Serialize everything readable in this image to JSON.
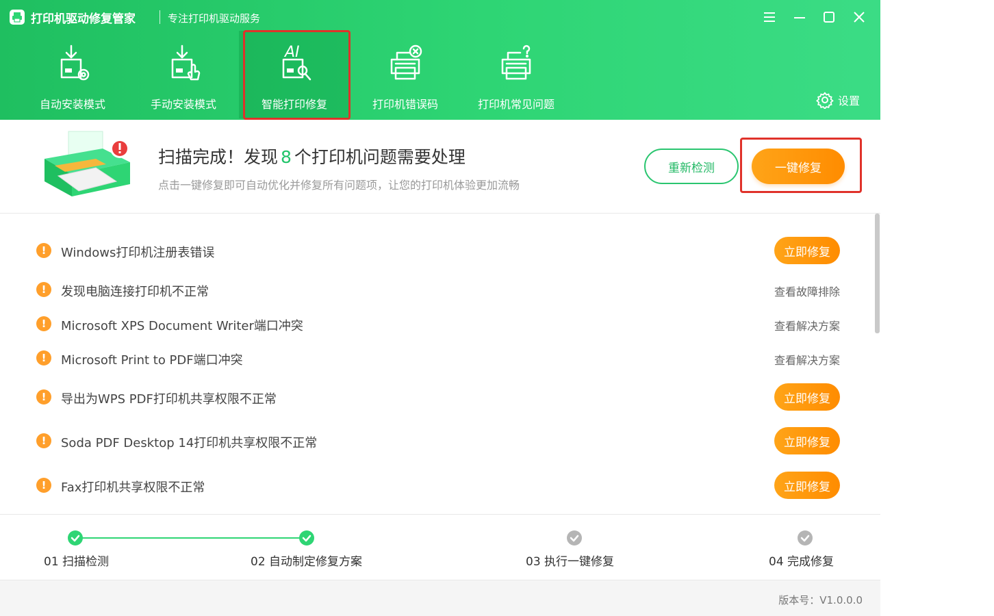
{
  "header": {
    "app_title": "打印机驱动修复管家",
    "app_subtitle": "专注打印机驱动服务",
    "settings_label": "设置",
    "window_controls": [
      "menu-icon",
      "minimize-icon",
      "maximize-icon",
      "close-icon"
    ]
  },
  "nav": {
    "items": [
      {
        "label": "自动安装模式",
        "icon": "auto-install-icon"
      },
      {
        "label": "手动安装模式",
        "icon": "manual-install-icon"
      },
      {
        "label": "智能打印修复",
        "icon": "ai-repair-icon",
        "active": true,
        "icon_text": "AI"
      },
      {
        "label": "打印机错误码",
        "icon": "printer-error-icon"
      },
      {
        "label": "打印机常见问题",
        "icon": "printer-faq-icon"
      }
    ]
  },
  "summary": {
    "title_prefix": "扫描完成！发现",
    "count": "8",
    "title_suffix": "个打印机问题需要处理",
    "description": "点击一键修复即可自动优化并修复所有问题项，让您的打印机体验更加流畅",
    "rescan_label": "重新检测",
    "fix_all_label": "一键修复"
  },
  "issues": [
    {
      "text": "Windows打印机注册表错误",
      "action": "立即修复",
      "action_type": "button"
    },
    {
      "text": "发现电脑连接打印机不正常",
      "action": "查看故障排除",
      "action_type": "link"
    },
    {
      "text": "Microsoft XPS Document Writer端口冲突",
      "action": "查看解决方案",
      "action_type": "link"
    },
    {
      "text": "Microsoft Print to PDF端口冲突",
      "action": "查看解决方案",
      "action_type": "link"
    },
    {
      "text": "导出为WPS PDF打印机共享权限不正常",
      "action": "立即修复",
      "action_type": "button"
    },
    {
      "text": "Soda PDF Desktop 14打印机共享权限不正常",
      "action": "立即修复",
      "action_type": "button"
    },
    {
      "text": "Fax打印机共享权限不正常",
      "action": "立即修复",
      "action_type": "button"
    }
  ],
  "steps": [
    {
      "label": "01 扫描检测",
      "done": true
    },
    {
      "label": "02 自动制定修复方案",
      "done": true
    },
    {
      "label": "03 执行一键修复",
      "done": false
    },
    {
      "label": "04 完成修复",
      "done": false
    }
  ],
  "footer": {
    "version": "版本号：V1.0.0.0"
  },
  "colors": {
    "brand_green": "#2ed574",
    "action_orange": "#ff9a10",
    "warning_orange": "#ff9f2b",
    "highlight_red": "#e0322a",
    "step_pending": "#b5b5b5"
  }
}
